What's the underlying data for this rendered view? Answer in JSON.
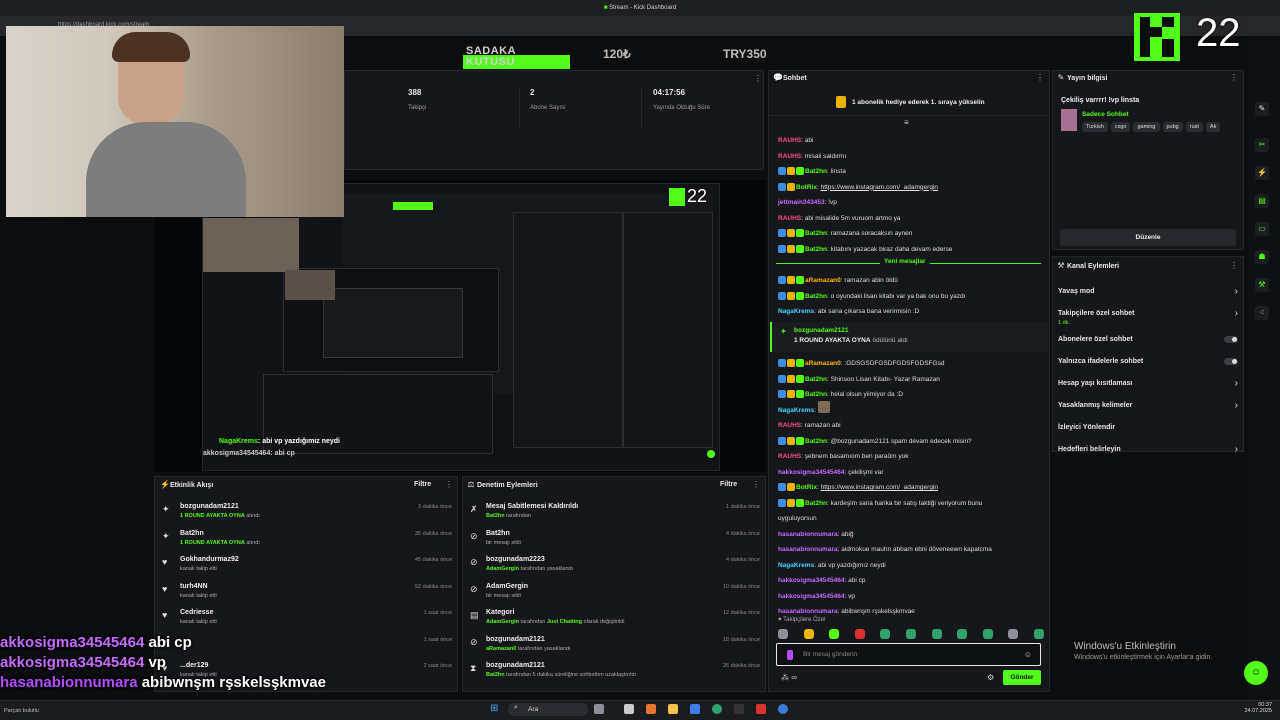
{
  "browser": {
    "tab_title": "Stream - Kick Dashboard",
    "url": "https://dashboard.kick.com/stream"
  },
  "topbar": {
    "sadaka_label": "SADAKA KUTUSU",
    "amount1": "120₺",
    "amount2": "TRY350",
    "viewer_count": "22"
  },
  "stats": [
    {
      "value": "388",
      "label": "Takipçi"
    },
    {
      "value": "2",
      "label": "Abone Sayısı"
    },
    {
      "value": "04:17:56",
      "label": "Yayında Olduğu Süre"
    }
  ],
  "activity_feed": {
    "title": "Etkinlik Akışı",
    "filter": "Filtre",
    "items": [
      {
        "user": "bozgunadam2121",
        "sub": "1 ROUND AYAKTA OYNA",
        "sub2": "alındı",
        "time": "3 dakika önce",
        "icon": "reward-icon"
      },
      {
        "user": "Bat2hn",
        "sub": "1 ROUND AYAKTA OYNA",
        "sub2": "alındı",
        "time": "35 dakika önce",
        "icon": "reward-icon"
      },
      {
        "user": "Gokhandurmaz92",
        "sub": "kanalı takip etti",
        "sub2": "",
        "time": "45 dakika önce",
        "icon": "heart-icon"
      },
      {
        "user": "turh4NN",
        "sub": "kanalı takip etti",
        "sub2": "",
        "time": "52 dakika önce",
        "icon": "heart-icon"
      },
      {
        "user": "Cedriesse",
        "sub": "kanalı takip etti",
        "sub2": "",
        "time": "1 saat önce",
        "icon": "heart-icon"
      },
      {
        "user": "",
        "sub": "",
        "sub2": "",
        "time": "1 saat önce",
        "icon": "heart-icon"
      },
      {
        "user": "...der129",
        "sub": "kanalı takip etti",
        "sub2": "",
        "time": "2 saat önce",
        "icon": "heart-icon"
      }
    ]
  },
  "mod_actions": {
    "title": "Denetim Eylemleri",
    "filter": "Filtre",
    "items": [
      {
        "title": "Mesaj Sabitlemesi Kaldırıldı",
        "who": "Bat2hn",
        "rest": "tarafından",
        "extra": "",
        "tail": "",
        "time": "1 dakika önce",
        "icon": "unpin-icon"
      },
      {
        "title": "Bat2hn",
        "who": "",
        "rest": "bir mesajı sildi",
        "extra": "",
        "tail": "",
        "time": "4 dakika önce",
        "icon": "delete-icon"
      },
      {
        "title": "bozgunadam2223",
        "who": "AdamGergin",
        "rest": "tarafından yasaklandı",
        "extra": "",
        "tail": "",
        "time": "4 dakika önce",
        "icon": "ban-icon"
      },
      {
        "title": "AdamGergin",
        "who": "",
        "rest": "bir mesajı sildi",
        "extra": "",
        "tail": "",
        "time": "10 dakika önce",
        "icon": "delete-icon"
      },
      {
        "title": "Kategori",
        "who": "AdamGergin",
        "rest": "tarafından",
        "extra": "Just Chatting",
        "tail": "olarak değiştirildi",
        "time": "12 dakika önce",
        "icon": "category-icon"
      },
      {
        "title": "bozgunadam2121",
        "who": "aRamazan0",
        "rest": "tarafından yasaklandı",
        "extra": "",
        "tail": "",
        "time": "18 dakika önce",
        "icon": "ban-icon"
      },
      {
        "title": "bozgunadam2121",
        "who": "Bat2hn",
        "rest": "tarafından 5 dakika süreliğine sohbetten uzaklaştırıldı",
        "extra": "",
        "tail": "",
        "time": "26 dakika önce",
        "icon": "timeout-icon"
      }
    ]
  },
  "chat": {
    "title": "Sohbet",
    "pinned": "1 abonelik hediye ederek 1. sıraya yükselin",
    "new_messages": "Yeni mesajlar",
    "lines": [
      {
        "user": "RAUHS",
        "color": "#ff4d8d",
        "badges": 0,
        "text": "abi",
        "link": false
      },
      {
        "user": "RAUHS",
        "color": "#ff4d8d",
        "badges": 0,
        "text": "misali saldırmı",
        "link": false
      },
      {
        "user": "Bat2hn",
        "color": "#53fc18",
        "badges": 3,
        "text": "linsta",
        "link": false
      },
      {
        "user": "BotRix",
        "color": "#53fc18",
        "badges": 2,
        "text": "https://www.instagram.com/_adamgergin",
        "link": true
      },
      {
        "user": "jettmain343453",
        "color": "#c76bff",
        "badges": 0,
        "text": "!vp",
        "link": false
      },
      {
        "user": "RAUHS",
        "color": "#ff4d8d",
        "badges": 0,
        "text": "abi misalide 5m vuruom artmo ya",
        "link": false
      },
      {
        "user": "Bat2hn",
        "color": "#53fc18",
        "badges": 3,
        "text": "ramazana soracaksın aynen",
        "link": false
      },
      {
        "user": "Bat2hn",
        "color": "#53fc18",
        "badges": 3,
        "text": "kitabını yazacak biraz daha devam ederse",
        "link": false
      }
    ],
    "lines2": [
      {
        "user": "aRamazan0",
        "color": "#ffb800",
        "badges": 3,
        "text": "ramazan abin öldü",
        "link": false
      },
      {
        "user": "Bat2hn",
        "color": "#53fc18",
        "badges": 3,
        "text": "o oyundaki lisan kitabı var ya bak onu bu yazdı",
        "link": false
      },
      {
        "user": "NagaKrems",
        "color": "#42d7ff",
        "badges": 0,
        "text": "abi sana çıkarsa bana verirmisin :D",
        "link": false
      }
    ],
    "redeem": {
      "user": "bozgunadam2121",
      "text": "1 ROUND AYAKTA OYNA",
      "suffix": "ödülünü aldı"
    },
    "lines3": [
      {
        "user": "aRamazan0",
        "color": "#ffb800",
        "badges": 3,
        "text": ":GDSGSDFGSDFGDSFGDSFGsd",
        "link": false
      },
      {
        "user": "Bat2hn",
        "color": "#53fc18",
        "badges": 3,
        "text": "Shinsoo Lisan Kitabı- Yazar Ramazan",
        "link": false
      },
      {
        "user": "Bat2hn",
        "color": "#53fc18",
        "badges": 3,
        "text": "helal olsun yiimiyor da :D",
        "link": false
      },
      {
        "user": "NagaKrems",
        "color": "#42d7ff",
        "badges": 0,
        "text": "",
        "link": false
      },
      {
        "user": "RAUHS",
        "color": "#ff4d8d",
        "badges": 0,
        "text": "ramazan abi",
        "link": false
      },
      {
        "user": "Bat2hn",
        "color": "#53fc18",
        "badges": 3,
        "text": "@bozgunadam2121 spam devam edecek misin?",
        "link": false
      },
      {
        "user": "RAUHS",
        "color": "#ff4d8d",
        "badges": 0,
        "text": "şebnem basamıom ben paraöm yok",
        "link": false
      },
      {
        "user": "hakkosigma34545464",
        "color": "#c76bff",
        "badges": 0,
        "text": "çekilişmi var",
        "link": false
      },
      {
        "user": "BotRix",
        "color": "#53fc18",
        "badges": 2,
        "text": "https://www.instagram.com/_adamgergin",
        "link": true
      },
      {
        "user": "Bat2hn",
        "color": "#53fc18",
        "badges": 3,
        "text": "kardeşim sana harika bir satış taktiği veriyorum bunu",
        "link": false
      },
      {
        "user": "",
        "color": "#e6e6e6",
        "badges": 0,
        "text": "uyguluyorsun",
        "link": false
      },
      {
        "user": "hasanabionnumara",
        "color": "#c76bff",
        "badges": 0,
        "text": "abiğ",
        "link": false
      },
      {
        "user": "hasanabionnumara",
        "color": "#c76bff",
        "badges": 0,
        "text": "aidmokue mauhn abbam ebni döveneewn kapatcma",
        "link": false
      },
      {
        "user": "NagaKrems",
        "color": "#42d7ff",
        "badges": 0,
        "text": "abi vp yazdığımız neydi",
        "link": false
      },
      {
        "user": "hakkosigma34545464",
        "color": "#c76bff",
        "badges": 0,
        "text": "abi cp",
        "link": false
      },
      {
        "user": "hakkosigma34545464",
        "color": "#c76bff",
        "badges": 0,
        "text": "vp",
        "link": false
      },
      {
        "user": "hasanabionnumara",
        "color": "#c76bff",
        "badges": 0,
        "text": "abibwnşm rşskelsşkmvae",
        "link": false
      }
    ],
    "followers_only": "Takipçilere Özel",
    "input_placeholder": "Bir mesaj gönderin",
    "send_label": "Gönder"
  },
  "stream_info": {
    "title": "Yayın bilgisi",
    "stream_title": "Çekiliş varrrr! !vp linsta",
    "category": "Sadece Sohbet",
    "tags": [
      "Turkish",
      "csgo",
      "gaming",
      "pubg",
      "rust",
      "Ak"
    ],
    "edit_label": "Düzenle"
  },
  "channel_actions": {
    "title": "Kanal Eylemleri",
    "items": [
      {
        "label": "Yavaş mod",
        "sub": "",
        "control": "chevron"
      },
      {
        "label": "Takipçilere özel sohbet",
        "sub": "1 dk.",
        "control": "chevron"
      },
      {
        "label": "Abonelere özel sohbet",
        "sub": "",
        "control": "toggle"
      },
      {
        "label": "Yalnızca ifadelerle sohbet",
        "sub": "",
        "control": "toggle"
      },
      {
        "label": "Hesap yaşı kısıtlaması",
        "sub": "",
        "control": "chevron"
      },
      {
        "label": "Yasaklanmış kelimeler",
        "sub": "",
        "control": "chevron"
      },
      {
        "label": "İzleyici Yönlendir",
        "sub": "",
        "control": "none"
      },
      {
        "label": "Hedefleri belirleyin",
        "sub": "",
        "control": "chevron"
      }
    ]
  },
  "windows_activation": {
    "title": "Windows'u Etkinleştirin",
    "sub": "Windows'u etkinleştirmek için Ayarlar'a gidin."
  },
  "overlay_chat": [
    {
      "user": "akkosigma34545464",
      "text": "abi cp"
    },
    {
      "user": "akkosigma34545464",
      "text": "vp"
    },
    {
      "user": "hasanabionnumara",
      "text": "abibwnşm rşskelsşkmvae"
    }
  ],
  "taskbar": {
    "search": "Ara",
    "time": "00:37",
    "date": "24.07.2025",
    "left_hint": "Parçalı bulutlu"
  },
  "nested_preview": {
    "viewer_count": "22",
    "chat_line_user": "NagaKrems",
    "chat_line_text": "abi vp yazdığımız neydi",
    "chat_line2": "akkosigma34545464: abi cp"
  },
  "colors": {
    "accent": "#53fc18",
    "panel": "#15171a",
    "background": "#0b0d0f"
  }
}
